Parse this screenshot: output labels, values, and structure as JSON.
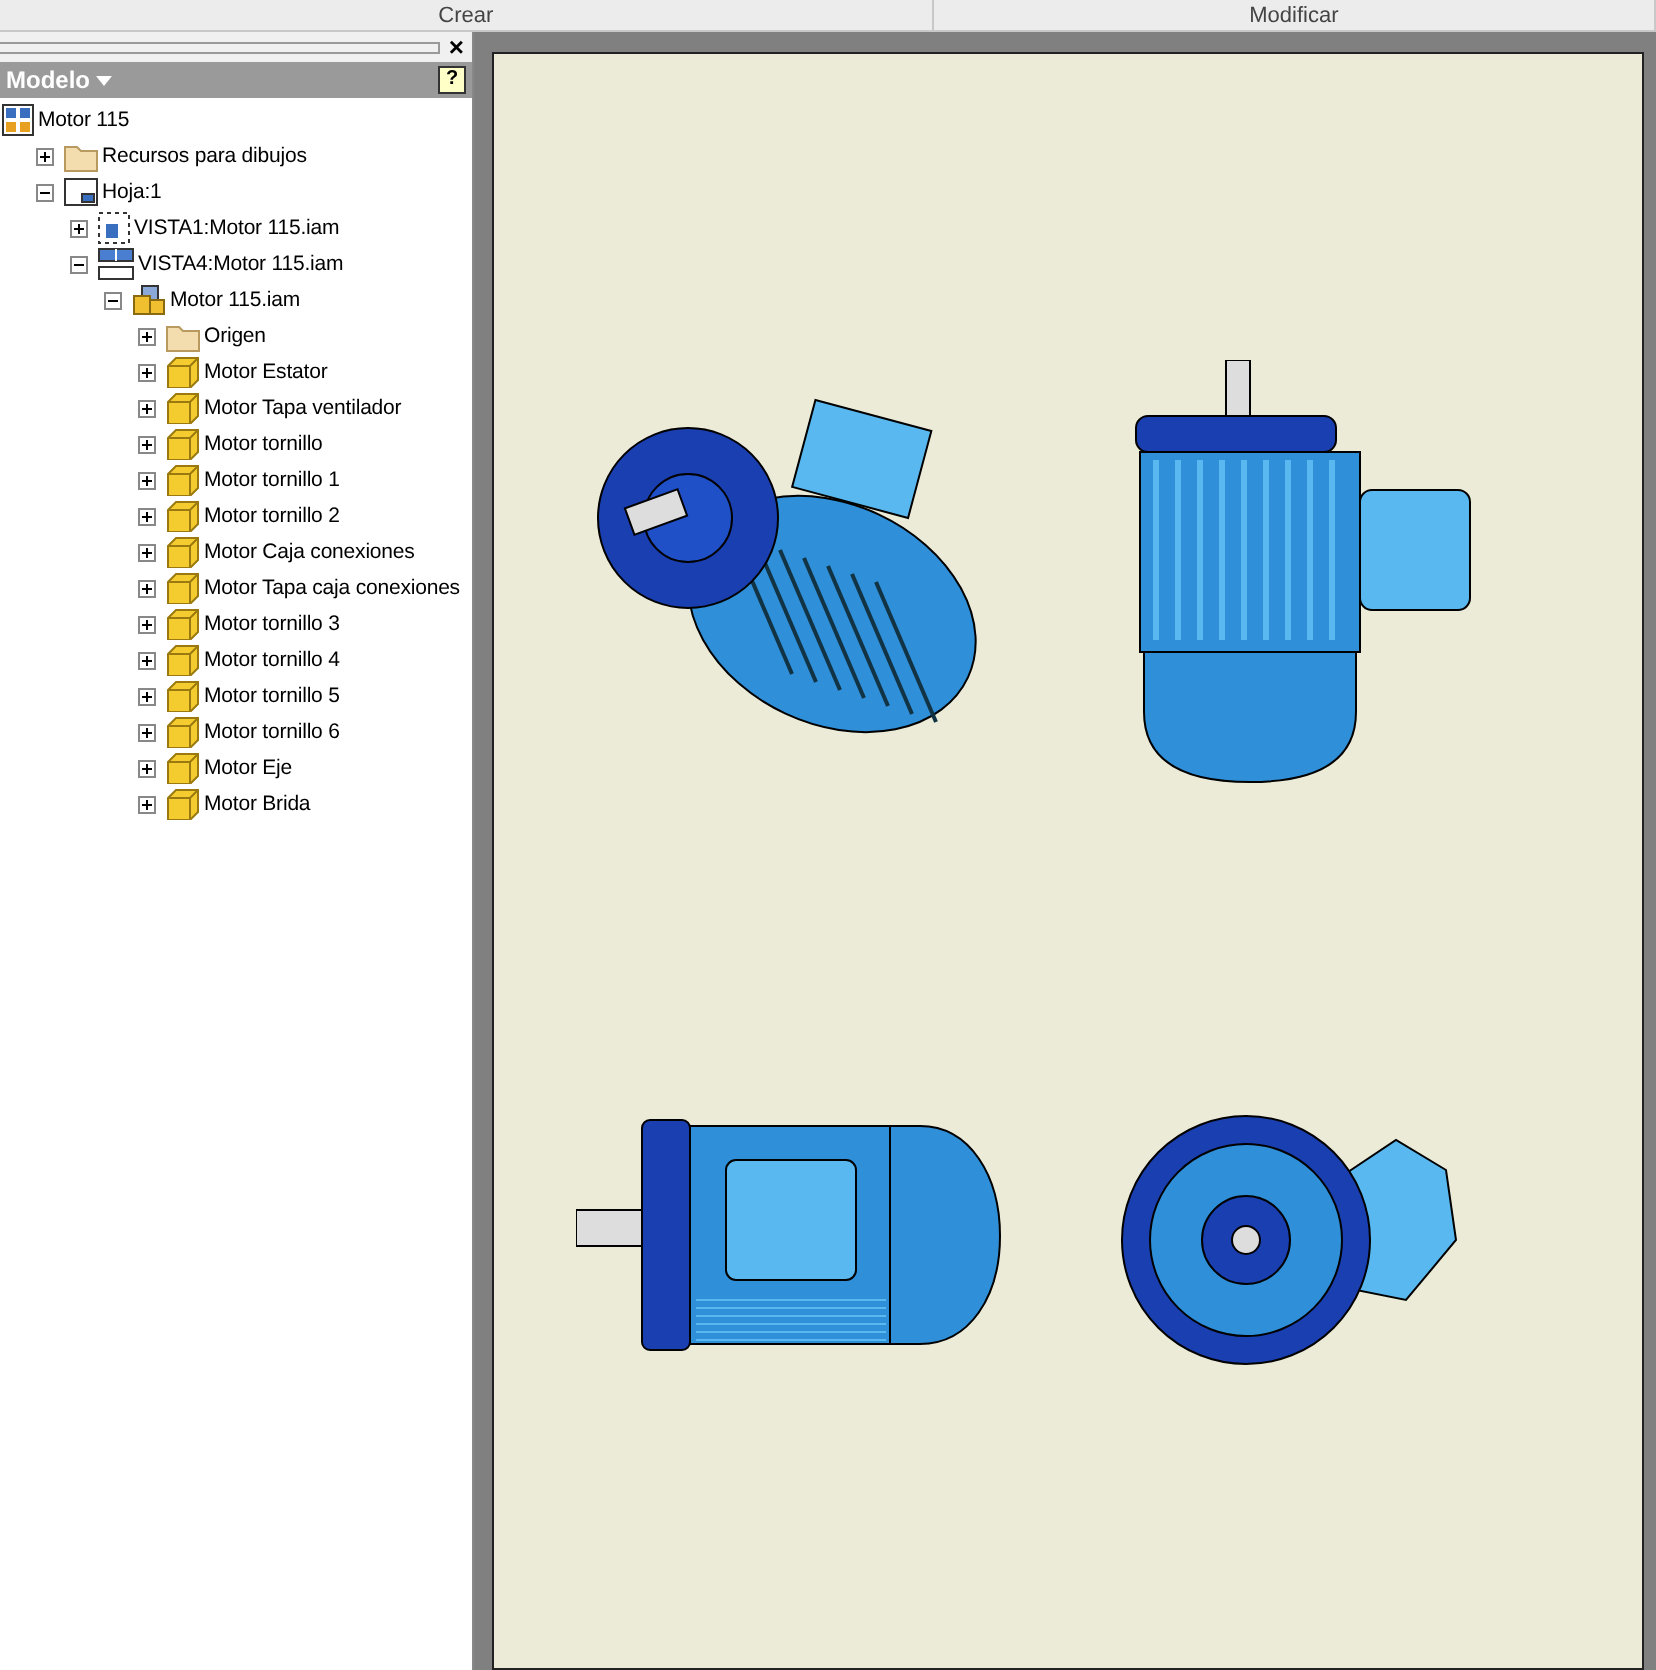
{
  "ribbon": {
    "panels": [
      "Crear",
      "Modificar"
    ]
  },
  "browser": {
    "title": "Modelo",
    "close_label": "×",
    "help_label": "?",
    "tree": [
      {
        "label": "Motor 115",
        "kind": "drawing",
        "children": [
          {
            "label": "Recursos para dibujos",
            "kind": "folder",
            "expanded": false
          },
          {
            "label": "Hoja:1",
            "kind": "sheet",
            "expanded": true,
            "children": [
              {
                "label": "VISTA1:Motor 115.iam",
                "kind": "view",
                "expanded": false
              },
              {
                "label": "VISTA4:Motor 115.iam",
                "kind": "views",
                "expanded": true,
                "children": [
                  {
                    "label": "Motor 115.iam",
                    "kind": "assembly",
                    "expanded": true,
                    "children": [
                      {
                        "label": "Origen",
                        "kind": "folder",
                        "expanded": false
                      },
                      {
                        "label": "Motor Estator",
                        "kind": "part",
                        "expanded": false
                      },
                      {
                        "label": "Motor Tapa ventilador",
                        "kind": "part",
                        "expanded": false
                      },
                      {
                        "label": "Motor tornillo",
                        "kind": "part",
                        "expanded": false
                      },
                      {
                        "label": "Motor tornillo 1",
                        "kind": "part",
                        "expanded": false
                      },
                      {
                        "label": "Motor tornillo 2",
                        "kind": "part",
                        "expanded": false
                      },
                      {
                        "label": "Motor Caja conexiones",
                        "kind": "part",
                        "expanded": false
                      },
                      {
                        "label": "Motor Tapa caja conexiones",
                        "kind": "part",
                        "expanded": false
                      },
                      {
                        "label": "Motor tornillo 3",
                        "kind": "part",
                        "expanded": false
                      },
                      {
                        "label": "Motor tornillo 4",
                        "kind": "part",
                        "expanded": false
                      },
                      {
                        "label": "Motor tornillo 5",
                        "kind": "part",
                        "expanded": false
                      },
                      {
                        "label": "Motor tornillo 6",
                        "kind": "part",
                        "expanded": false
                      },
                      {
                        "label": "Motor Eje",
                        "kind": "part",
                        "expanded": false
                      },
                      {
                        "label": "Motor Brida",
                        "kind": "part",
                        "expanded": false
                      }
                    ]
                  }
                ]
              }
            ]
          }
        ]
      }
    ]
  },
  "sheet": {
    "views": [
      {
        "kind": "iso"
      },
      {
        "kind": "top"
      },
      {
        "kind": "side"
      },
      {
        "kind": "front"
      }
    ]
  }
}
